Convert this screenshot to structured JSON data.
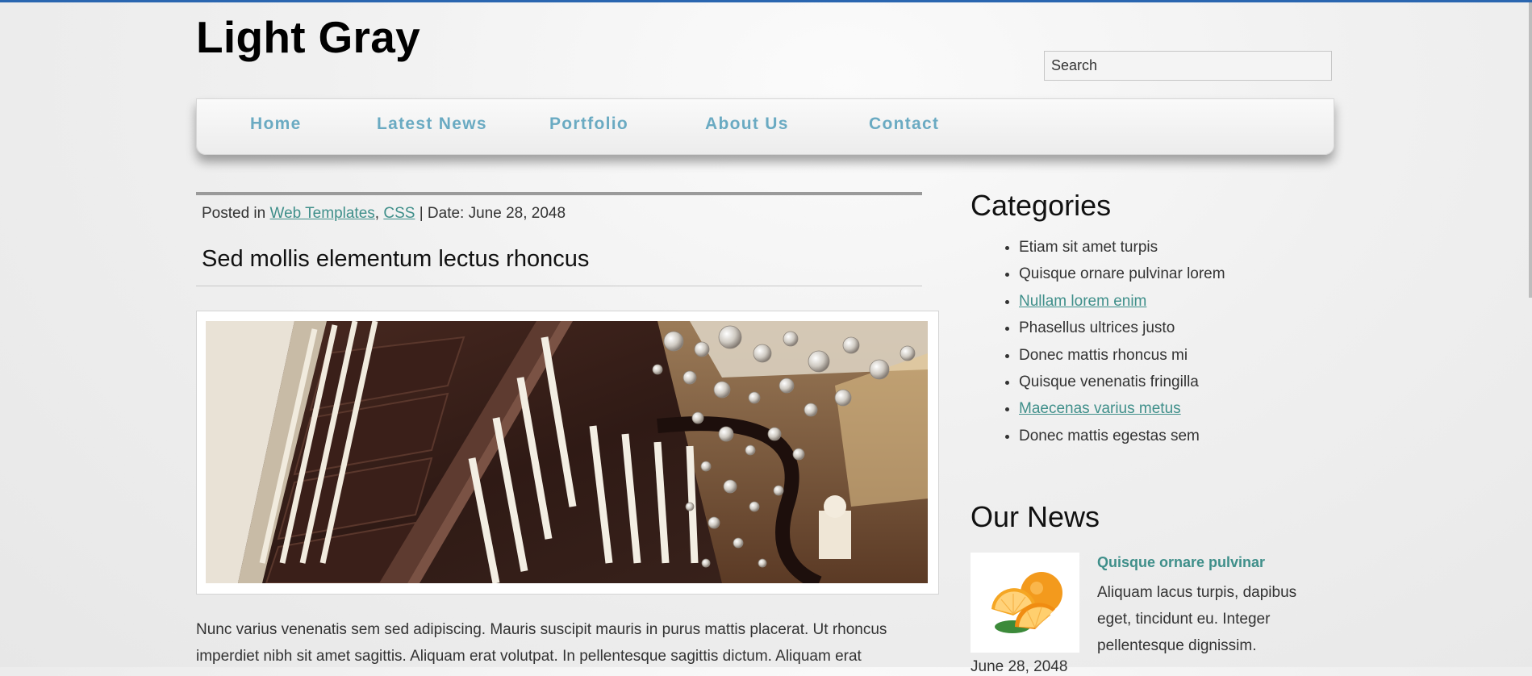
{
  "site": {
    "title": "Light Gray"
  },
  "search": {
    "placeholder": "Search"
  },
  "nav": {
    "items": [
      {
        "label": "Home"
      },
      {
        "label": "Latest News"
      },
      {
        "label": "Portfolio"
      },
      {
        "label": "About Us"
      },
      {
        "label": "Contact"
      }
    ]
  },
  "post": {
    "meta_prefix": "Posted in",
    "categories": [
      "Web Templates",
      "CSS"
    ],
    "category_separator": ",",
    "date_label": "| Date: June 28, 2048",
    "title": "Sed mollis elementum lectus rhoncus",
    "image_subject": "spiral staircase with crystal chandelier",
    "body": "Nunc varius venenatis sem sed adipiscing. Mauris suscipit mauris in purus mattis placerat. Ut rhoncus imperdiet nibh sit amet sagittis. Aliquam erat volutpat. In pellentesque sagittis dictum. Aliquam erat"
  },
  "sidebar": {
    "categories": {
      "heading": "Categories",
      "items": [
        {
          "label": "Etiam sit amet turpis"
        },
        {
          "label": "Quisque ornare pulvinar lorem"
        },
        {
          "label": "Nullam lorem enim"
        },
        {
          "label": "Phasellus ultrices justo"
        },
        {
          "label": "Donec mattis rhoncus mi"
        },
        {
          "label": "Quisque venenatis fringilla"
        },
        {
          "label": "Maecenas varius metus"
        },
        {
          "label": "Donec mattis egestas sem"
        }
      ]
    },
    "news": {
      "heading": "Our News",
      "thumb_subject": "orange slices",
      "item_title": "Quisque ornare pulvinar",
      "item_excerpt": "Aliquam lacus turpis, dapibus eget, tincidunt eu. Integer pellentesque dignissim.",
      "item_date": "June 28, 2048"
    }
  },
  "colors": {
    "accent_bar": "#2a66b0",
    "nav_link": "#6aaac2",
    "link": "#3f8f8a",
    "text": "#333333"
  }
}
